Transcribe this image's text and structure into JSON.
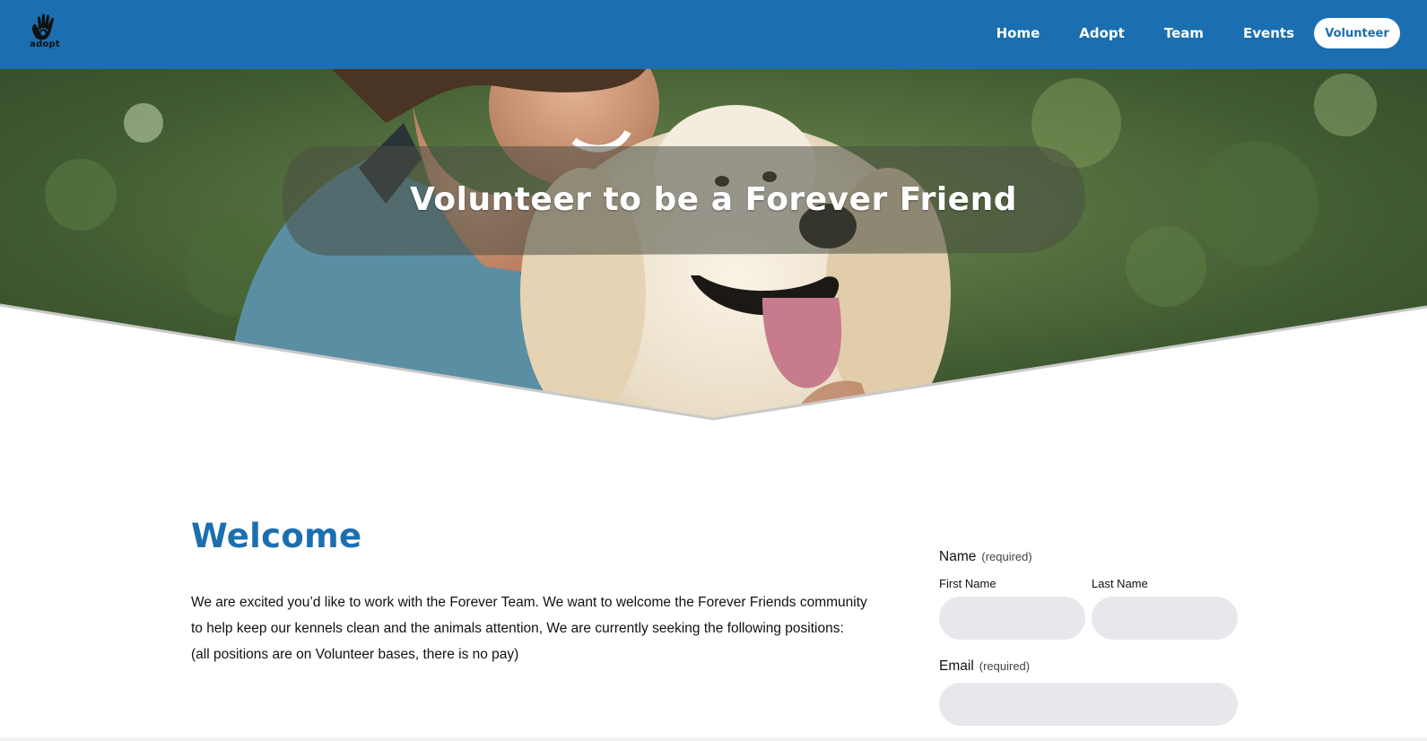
{
  "header": {
    "logo_text": "adopt",
    "nav": {
      "home": "Home",
      "adopt": "Adopt",
      "team": "Team",
      "events": "Events",
      "volunteer": "Volunteer"
    },
    "bg_color": "#1b6fb0"
  },
  "hero": {
    "title": "Volunteer to be a Forever Friend",
    "image": "woman-hugging-golden-retriever-photo"
  },
  "welcome": {
    "title": "Welcome",
    "line1": "We are excited you’d like to work with the Forever Team. We want to welcome the Forever Friends community",
    "line2": "to help keep our kennels clean and the animals attention, We are currently seeking the following positions:",
    "line3": "(all positions are on Volunteer bases, there is no pay)"
  },
  "form": {
    "name_label": "Name",
    "name_required": "(required)",
    "first_name_label": "First Name",
    "last_name_label": "Last Name",
    "email_label": "Email",
    "email_required": "(required)",
    "first_name_value": "",
    "last_name_value": "",
    "email_value": ""
  },
  "colors": {
    "accent": "#1b6fb0",
    "input_bg": "#e8e8ec"
  }
}
